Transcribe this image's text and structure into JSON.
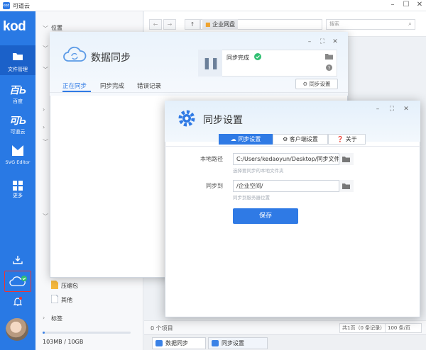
{
  "window": {
    "title": "可道云",
    "logo_text": "kod"
  },
  "leftnav": {
    "brand": "kod",
    "items": [
      {
        "icon": "folder-icon",
        "label": "文件管理"
      },
      {
        "icon": "baidu-icon",
        "glyph": "百Ь",
        "label": "百度"
      },
      {
        "icon": "kedaoyun-icon",
        "glyph": "可Ь",
        "label": "可道云"
      },
      {
        "icon": "svg-editor-icon",
        "label": "SVG Editor"
      },
      {
        "icon": "more-icon",
        "label": "更多"
      }
    ]
  },
  "tree": {
    "location": "位置",
    "items": [
      {
        "label": "压缩包"
      },
      {
        "label": "其他"
      }
    ],
    "tags": "标签",
    "quota": "103MB / 10GB",
    "quota_used_percent": 1
  },
  "toolbar": {
    "breadcrumb": "企业网盘",
    "search_placeholder": "搜索"
  },
  "status": {
    "items": "0 个项目",
    "pages": "共1页（0 条记录）",
    "per_page": "100 条/页"
  },
  "taskbar": [
    {
      "label": "数据同步"
    },
    {
      "label": "同步设置"
    }
  ],
  "sync_dialog": {
    "title": "数据同步",
    "tabs": [
      "正在同步",
      "同步完成",
      "错误记录"
    ],
    "status": "同步完成",
    "settings_button": "同步设置"
  },
  "settings_dialog": {
    "title": "同步设置",
    "tabs": [
      "同步设置",
      "客户端设置",
      "关于"
    ],
    "local_path_label": "本地路径",
    "local_path_value": "C:/Users/kedaoyun/Desktop/同步文件夹",
    "local_path_hint": "选择要同步的本地文件夹",
    "sync_to_label": "同步到",
    "sync_to_value": "/企业空间/",
    "sync_to_hint": "同步到服务器位置",
    "save_label": "保存"
  },
  "colors": {
    "accent": "#2f7ae5",
    "nav": "#2979e4",
    "alert": "#e33333",
    "success": "#2fbf71"
  }
}
